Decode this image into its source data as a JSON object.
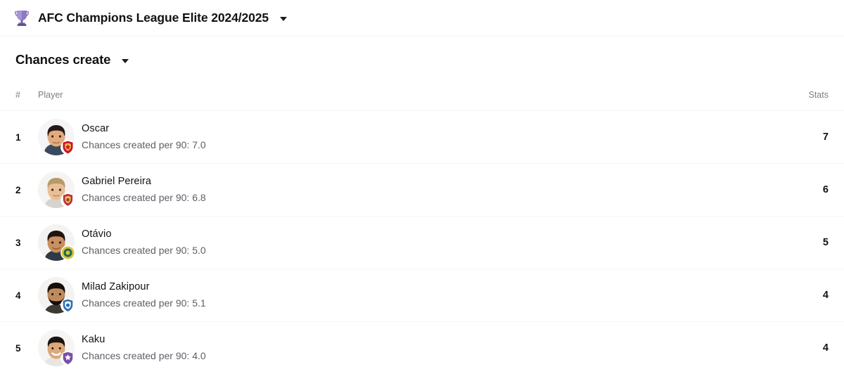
{
  "competition": {
    "icon": "trophy-icon",
    "name": "AFC Champions League Elite 2024/2025",
    "dropdown_icon": "chevron-down-icon"
  },
  "stat_selector": {
    "label": "Chances create",
    "dropdown_icon": "chevron-down-icon"
  },
  "table": {
    "columns": {
      "rank": "#",
      "player": "Player",
      "stats": "Stats"
    },
    "rows": [
      {
        "rank": "1",
        "name": "Oscar",
        "detail": "Chances created per 90: 7.0",
        "stat": "7",
        "avatar_icon": "player-avatar",
        "badge_icon": "club-badge-shanghai-port",
        "badge_color": "#c8102e",
        "skin": "#e8b98f",
        "hair": "#241a16"
      },
      {
        "rank": "2",
        "name": "Gabriel Pereira",
        "detail": "Chances created per 90: 6.8",
        "stat": "6",
        "avatar_icon": "player-avatar",
        "badge_icon": "club-badge-shanghai-port",
        "badge_color": "#b8303a",
        "skin": "#e9bf96",
        "hair": "#b89a68"
      },
      {
        "rank": "3",
        "name": "Otávio",
        "detail": "Chances created per 90: 5.0",
        "stat": "5",
        "avatar_icon": "player-avatar",
        "badge_icon": "club-badge-al-nassr",
        "badge_color": "#d8c23a",
        "skin": "#c98f5e",
        "hair": "#1e1410"
      },
      {
        "rank": "4",
        "name": "Milad Zakipour",
        "detail": "Chances created per 90: 5.1",
        "stat": "4",
        "avatar_icon": "player-avatar",
        "badge_icon": "club-badge-esteghlal",
        "badge_color": "#2f6fb5",
        "skin": "#c08b5c",
        "hair": "#150f0c"
      },
      {
        "rank": "5",
        "name": "Kaku",
        "detail": "Chances created per 90: 4.0",
        "stat": "4",
        "avatar_icon": "player-avatar",
        "badge_icon": "club-badge-al-ain",
        "badge_color": "#7b4fa8",
        "skin": "#dda87a",
        "hair": "#1a1310"
      }
    ]
  },
  "colors": {
    "trophy": "#7d6bb5",
    "row_divider": "#f6f6f8",
    "subtext": "#5c5f66",
    "header_text": "#7a7d85"
  }
}
